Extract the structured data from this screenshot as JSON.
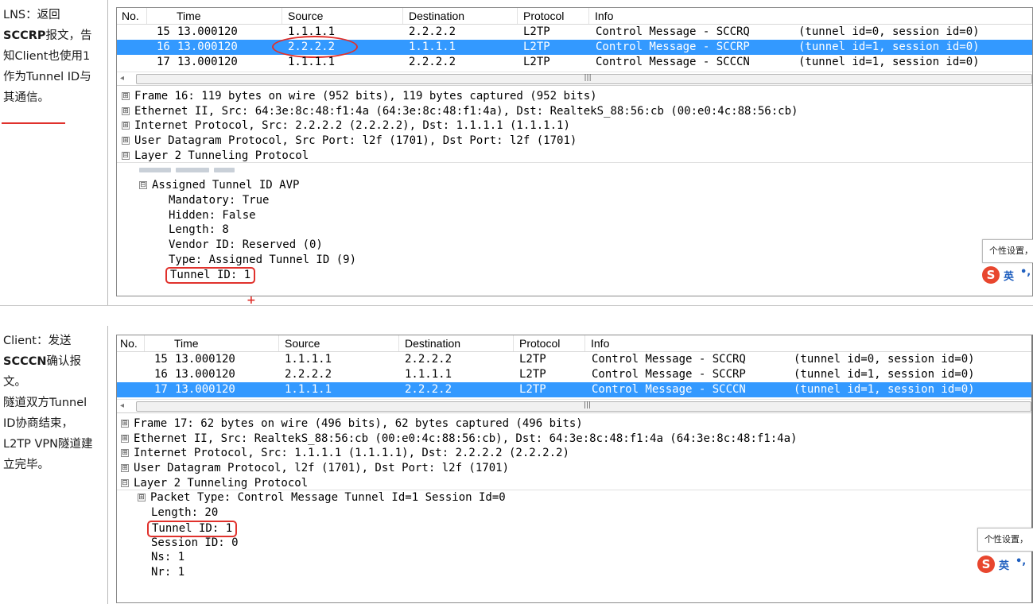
{
  "columns": {
    "no": "No.",
    "time": "Time",
    "source": "Source",
    "destination": "Destination",
    "protocol": "Protocol",
    "info": "Info"
  },
  "panel1": {
    "note": {
      "line1": "LNS：返回",
      "line2_bold": "SCCRP",
      "line2_rest": "报文，告",
      "line3": "知Client也使用1",
      "line4": "作为Tunnel ID与",
      "line5": "其通信。"
    },
    "packets": [
      {
        "no": "15",
        "time": "13.000120",
        "source": "1.1.1.1",
        "destination": "2.2.2.2",
        "protocol": "L2TP",
        "info": "Control Message - SCCRQ",
        "ids": "(tunnel id=0, session id=0)",
        "selected": false
      },
      {
        "no": "16",
        "time": "13.000120",
        "source": "2.2.2.2",
        "destination": "1.1.1.1",
        "protocol": "L2TP",
        "info": "Control Message - SCCRP",
        "ids": "(tunnel id=1, session id=0)",
        "selected": true
      },
      {
        "no": "17",
        "time": "13.000120",
        "source": "1.1.1.1",
        "destination": "2.2.2.2",
        "protocol": "L2TP",
        "info": "Control Message - SCCCN",
        "ids": "(tunnel id=1, session id=0)",
        "selected": false
      }
    ],
    "details": {
      "frame": "Frame 16: 119 bytes on wire (952 bits), 119 bytes captured (952 bits)",
      "ethernet": "Ethernet II, Src: 64:3e:8c:48:f1:4a (64:3e:8c:48:f1:4a), Dst: RealtekS_88:56:cb (00:e0:4c:88:56:cb)",
      "ip": "Internet Protocol, Src: 2.2.2.2 (2.2.2.2), Dst: 1.1.1.1 (1.1.1.1)",
      "udp": "User Datagram Protocol, Src Port: l2f (1701), Dst Port: l2f (1701)",
      "l2tp": "Layer 2 Tunneling Protocol",
      "avp": "Assigned Tunnel ID AVP",
      "mandatory": "Mandatory: True",
      "hidden": "Hidden: False",
      "length": "Length: 8",
      "vendor": "Vendor ID: Reserved (0)",
      "type": "Type: Assigned Tunnel ID (9)",
      "tunnel_id": "Tunnel ID: 1"
    }
  },
  "panel2": {
    "note": {
      "line1": "Client：发送",
      "line2_bold": "SCCCN",
      "line2_rest": "确认报",
      "line3": "文。",
      "line4": "隧道双方Tunnel",
      "line5": "ID协商结束，",
      "line6": "L2TP VPN隧道建",
      "line7": "立完毕。"
    },
    "packets": [
      {
        "no": "15",
        "time": "13.000120",
        "source": "1.1.1.1",
        "destination": "2.2.2.2",
        "protocol": "L2TP",
        "info": "Control Message - SCCRQ",
        "ids": "(tunnel id=0, session id=0)",
        "selected": false
      },
      {
        "no": "16",
        "time": "13.000120",
        "source": "2.2.2.2",
        "destination": "1.1.1.1",
        "protocol": "L2TP",
        "info": "Control Message - SCCRP",
        "ids": "(tunnel id=1, session id=0)",
        "selected": false
      },
      {
        "no": "17",
        "time": "13.000120",
        "source": "1.1.1.1",
        "destination": "2.2.2.2",
        "protocol": "L2TP",
        "info": "Control Message - SCCCN",
        "ids": "(tunnel id=1, session id=0)",
        "selected": true
      }
    ],
    "details": {
      "frame": "Frame 17: 62 bytes on wire (496 bits), 62 bytes captured (496 bits)",
      "ethernet": "Ethernet II, Src: RealtekS_88:56:cb (00:e0:4c:88:56:cb), Dst: 64:3e:8c:48:f1:4a (64:3e:8c:48:f1:4a)",
      "ip": "Internet Protocol, Src: 1.1.1.1 (1.1.1.1), Dst: 2.2.2.2 (2.2.2.2)",
      "udp": "User Datagram Protocol, l2f (1701), Dst Port: l2f (1701)",
      "l2tp": "Layer 2 Tunneling Protocol",
      "packet_type": "Packet Type: Control Message Tunnel Id=1 Session Id=0",
      "length": "Length: 20",
      "tunnel_id": "Tunnel ID: 1",
      "session_id": "Session ID: 0",
      "ns": "Ns: 1",
      "nr": "Nr: 1"
    }
  },
  "ime": {
    "popup": "个性设置，",
    "logo": "S",
    "lang": "英",
    "punct": "•,"
  },
  "colors": {
    "selection": "#3399ff",
    "annotation_red": "#e0312c"
  },
  "icons": {
    "expand": "⊞",
    "collapse": "⊟",
    "scroll_left": "◂",
    "grip": "|||"
  }
}
